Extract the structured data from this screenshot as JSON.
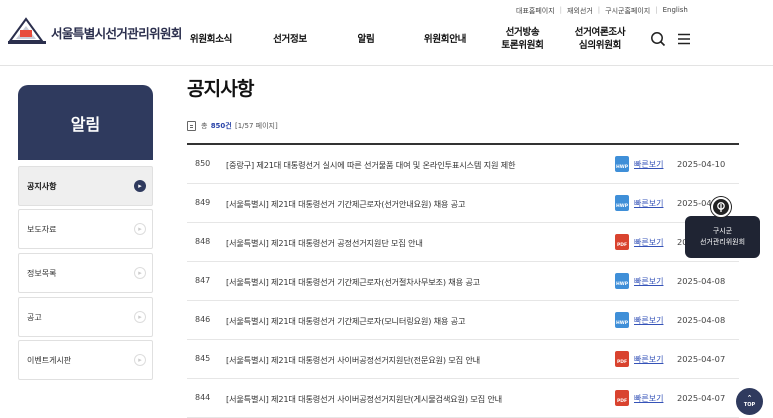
{
  "header": {
    "logo_text": "서울특별시선거관리위원회",
    "util_links": [
      "대표홈페이지",
      "재외선거",
      "구시군홈페이지",
      "English"
    ],
    "nav": [
      "위원회소식",
      "선거정보",
      "알림",
      "위원회안내",
      "선거방송\n토론위원회",
      "선거여론조사\n심의위원회"
    ]
  },
  "sidebar": {
    "title": "알림",
    "items": [
      {
        "label": "공지사항",
        "active": true
      },
      {
        "label": "보도자료",
        "active": false
      },
      {
        "label": "정보목록",
        "active": false
      },
      {
        "label": "공고",
        "active": false
      },
      {
        "label": "이벤트게시판",
        "active": false
      }
    ]
  },
  "main": {
    "title": "공지사항",
    "count": {
      "prefix": "총",
      "total": "850건",
      "pages": "[1/57 페이지]"
    },
    "rows": [
      {
        "num": "850",
        "title": "[중랑구] 제21대 대통령선거 실시에 따른 선거물품 대여 및 온라인투표시스템 지원 제한",
        "file": "HWP",
        "quick": "빠른보기",
        "date": "2025-04-10"
      },
      {
        "num": "849",
        "title": "[서울특별시] 제21대 대통령선거 기간제근로자(선거안내요원) 채용 공고",
        "file": "HWP",
        "quick": "빠른보기",
        "date": "2025-04-"
      },
      {
        "num": "848",
        "title": "[서울특별시] 제21대 대통령선거 공정선거지원단 모집 안내",
        "file": "PDF",
        "quick": "빠른보기",
        "date": "20"
      },
      {
        "num": "847",
        "title": "[서울특별시] 제21대 대통령선거 기간제근로자(선거절차사무보조) 채용 공고",
        "file": "HWP",
        "quick": "빠른보기",
        "date": "2025-04-08"
      },
      {
        "num": "846",
        "title": "[서울특별시] 제21대 대통령선거 기간제근로자(모니터링요원) 채용 공고",
        "file": "HWP",
        "quick": "빠른보기",
        "date": "2025-04-08"
      },
      {
        "num": "845",
        "title": "[서울특별시] 제21대 대통령선거 사이버공정선거지원단(전문요원) 모집 안내",
        "file": "PDF",
        "quick": "빠른보기",
        "date": "2025-04-07"
      },
      {
        "num": "844",
        "title": "[서울특별시] 제21대 대통령선거 사이버공정선거지원단(게시물검색요원) 모집 안내",
        "file": "PDF",
        "quick": "빠른보기",
        "date": "2025-04-07"
      }
    ]
  },
  "floating": {
    "gu_line1": "구시군",
    "gu_line2": "선거관리위원회",
    "top_label": "TOP"
  },
  "colors": {
    "primary": "#2f3a5e",
    "link": "#3553b8",
    "hwp": "#3f8fd8",
    "pdf": "#d9432f"
  },
  "icons": [
    "logo-mark-icon",
    "search-icon",
    "menu-icon",
    "chevron-right-icon",
    "document-icon",
    "hwp-file-icon",
    "pdf-file-icon",
    "location-pin-icon",
    "arrow-up-icon"
  ]
}
